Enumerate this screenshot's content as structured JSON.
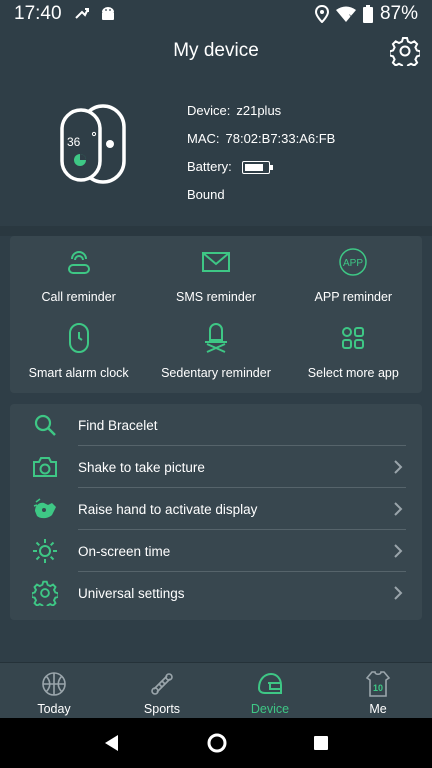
{
  "status_bar": {
    "time": "17:40",
    "battery_percent": "87%",
    "icons": [
      "missed-call-icon",
      "android-icon",
      "location-icon",
      "wifi-icon",
      "battery-icon"
    ]
  },
  "header": {
    "title": "My device",
    "settings_icon": "gear-icon"
  },
  "device": {
    "display_temp": "36",
    "device_label": "Device:",
    "device_name": "z21plus",
    "mac_label": "MAC:",
    "mac": "78:02:B7:33:A6:FB",
    "battery_label": "Battery:",
    "battery_level": 0.85,
    "status": "Bound"
  },
  "reminders": [
    {
      "label": "Call reminder",
      "icon": "phone-icon"
    },
    {
      "label": "SMS reminder",
      "icon": "envelope-icon"
    },
    {
      "label": "APP reminder",
      "icon": "app-icon",
      "icon_text": "APP"
    },
    {
      "label": "Smart alarm clock",
      "icon": "watch-icon"
    },
    {
      "label": "Sedentary reminder",
      "icon": "sedentary-icon"
    },
    {
      "label": "Select more app",
      "icon": "apps-grid-icon"
    }
  ],
  "settings": [
    {
      "label": "Find Bracelet",
      "icon": "search-icon"
    },
    {
      "label": "Shake to take picture",
      "icon": "camera-icon"
    },
    {
      "label": "Raise hand to activate display",
      "icon": "raise-hand-icon"
    },
    {
      "label": "On-screen time",
      "icon": "sun-icon"
    },
    {
      "label": "Universal settings",
      "icon": "gear-icon"
    }
  ],
  "bottom_nav": [
    {
      "label": "Today",
      "icon": "basketball-icon",
      "active": false
    },
    {
      "label": "Sports",
      "icon": "sports-icon",
      "active": false
    },
    {
      "label": "Device",
      "icon": "helmet-icon",
      "active": true
    },
    {
      "label": "Me",
      "icon": "jersey-icon",
      "icon_text": "10",
      "active": false
    }
  ],
  "colors": {
    "background": "#2f3e47",
    "card": "#38474f",
    "accent": "#3ec785"
  }
}
